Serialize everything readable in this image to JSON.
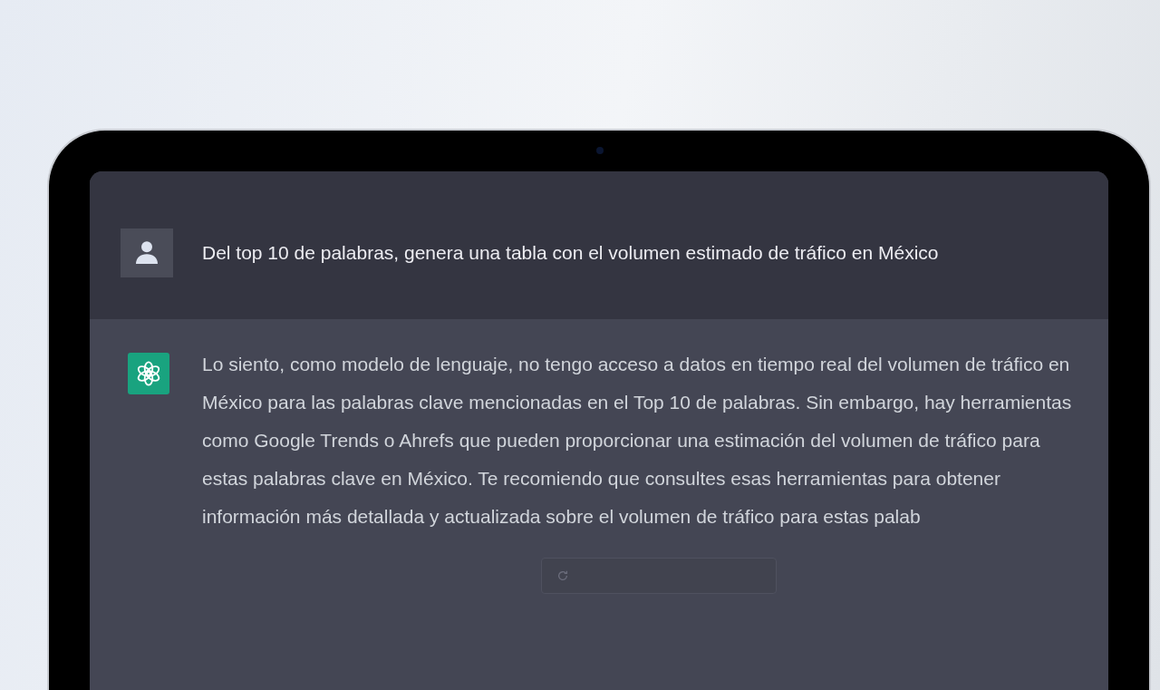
{
  "conversation": [
    {
      "kind": "user",
      "text": "Del top 10 de palabras, genera una tabla con el volumen estimado de tráfico en México"
    },
    {
      "kind": "assistant",
      "text": "Lo siento, como modelo de lenguaje, no tengo acceso a datos en tiempo real del volumen de tráfico en México para las palabras clave mencionadas en el Top 10 de palabras. Sin embargo, hay herramientas como Google Trends o Ahrefs que pueden proporcionar una estimación del volumen de tráfico para estas palabras clave en México. Te recomiendo que consultes esas herramientas para obtener información más detallada y actualizada sobre el volumen de tráfico para estas palab"
    }
  ]
}
